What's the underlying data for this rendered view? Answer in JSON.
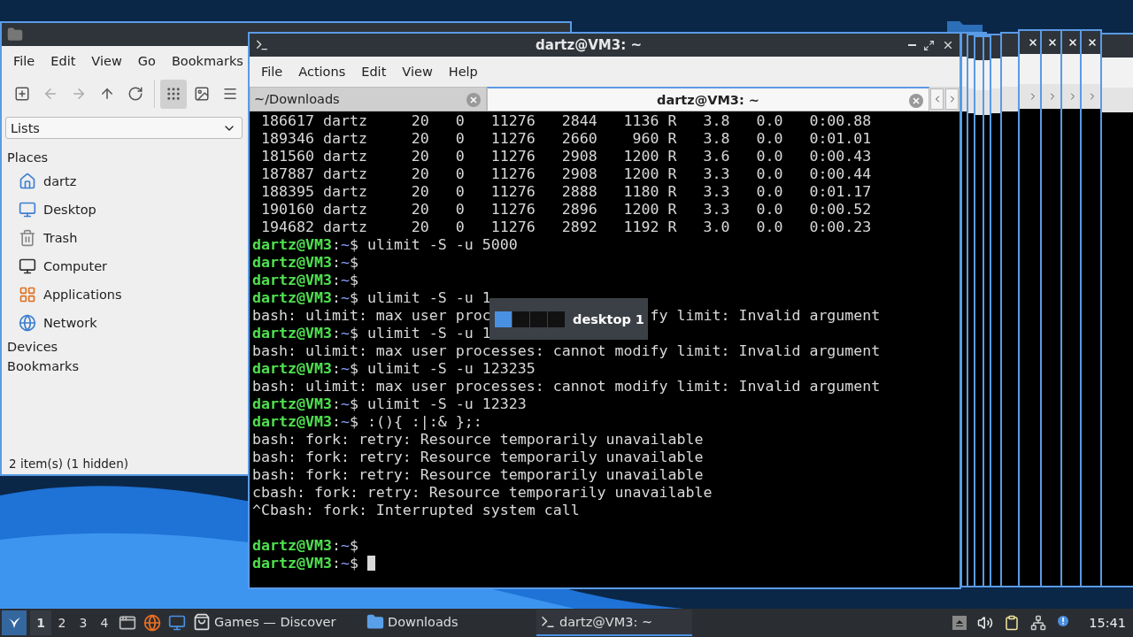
{
  "file_manager": {
    "menu": [
      "File",
      "Edit",
      "View",
      "Go",
      "Bookmarks"
    ],
    "view_modes": [
      {
        "kind": "icons",
        "selected": true
      },
      {
        "kind": "thumbnails",
        "selected": false
      },
      {
        "kind": "list",
        "selected": false
      }
    ],
    "view_select": {
      "value": "Lists"
    },
    "sections": [
      {
        "title": "Places",
        "items": [
          {
            "label": "dartz",
            "kind": "home"
          },
          {
            "label": "Desktop",
            "kind": "desktop"
          },
          {
            "label": "Trash",
            "kind": "trash"
          },
          {
            "label": "Computer",
            "kind": "computer"
          },
          {
            "label": "Applications",
            "kind": "apps"
          },
          {
            "label": "Network",
            "kind": "network"
          }
        ]
      },
      {
        "title": "Devices"
      },
      {
        "title": "Bookmarks"
      }
    ],
    "status": "2 item(s) (1 hidden)"
  },
  "terminal": {
    "title": "dartz@VM3: ~",
    "menu": [
      "File",
      "Actions",
      "Edit",
      "View",
      "Help"
    ],
    "tabs": [
      {
        "label": "~/Downloads",
        "selected": false
      },
      {
        "label": "dartz@VM3: ~",
        "selected": true
      }
    ],
    "lines": [
      {
        "kind": "output",
        "text": " 186617 dartz     20   0   11276   2844   1136 R   3.8   0.0   0:00.88"
      },
      {
        "kind": "output",
        "text": " 189346 dartz     20   0   11276   2660    960 R   3.8   0.0   0:01.01"
      },
      {
        "kind": "output",
        "text": " 181560 dartz     20   0   11276   2908   1200 R   3.6   0.0   0:00.43"
      },
      {
        "kind": "output",
        "text": " 187887 dartz     20   0   11276   2908   1200 R   3.3   0.0   0:00.44"
      },
      {
        "kind": "output",
        "text": " 188395 dartz     20   0   11276   2888   1180 R   3.3   0.0   0:01.17"
      },
      {
        "kind": "output",
        "text": " 190160 dartz     20   0   11276   2896   1200 R   3.3   0.0   0:00.52"
      },
      {
        "kind": "output",
        "text": " 194682 dartz     20   0   11276   2892   1192 R   3.0   0.0   0:00.23"
      },
      {
        "kind": "prompt",
        "user": "dartz@VM3",
        "sep": ":",
        "path": "~",
        "symbol": "$",
        "command": " ulimit -S -u 5000"
      },
      {
        "kind": "prompt",
        "user": "dartz@VM3",
        "sep": ":",
        "path": "~",
        "symbol": "$"
      },
      {
        "kind": "prompt",
        "user": "dartz@VM3",
        "sep": ":",
        "path": "~",
        "symbol": "$"
      },
      {
        "kind": "prompt",
        "user": "dartz@VM3",
        "sep": ":",
        "path": "~",
        "symbol": "$",
        "command": " ulimit -S -u 1"
      },
      {
        "kind": "output",
        "text": "bash: ulimit: max user proc",
        "after": "fy limit: Invalid argument"
      },
      {
        "kind": "prompt",
        "user": "dartz@VM3",
        "sep": ":",
        "path": "~",
        "symbol": "$",
        "command": " ulimit -S -u 1"
      },
      {
        "kind": "output",
        "text": "bash: ulimit: max user processes: cannot modify limit: Invalid argument"
      },
      {
        "kind": "prompt",
        "user": "dartz@VM3",
        "sep": ":",
        "path": "~",
        "symbol": "$",
        "command": " ulimit -S -u 123235"
      },
      {
        "kind": "output",
        "text": "bash: ulimit: max user processes: cannot modify limit: Invalid argument"
      },
      {
        "kind": "prompt",
        "user": "dartz@VM3",
        "sep": ":",
        "path": "~",
        "symbol": "$",
        "command": " ulimit -S -u 12323"
      },
      {
        "kind": "prompt",
        "user": "dartz@VM3",
        "sep": ":",
        "path": "~",
        "symbol": "$",
        "command": " :(){ :|:& };:"
      },
      {
        "kind": "output",
        "text": "bash: fork: retry: Resource temporarily unavailable"
      },
      {
        "kind": "output",
        "text": "bash: fork: retry: Resource temporarily unavailable"
      },
      {
        "kind": "output",
        "text": "bash: fork: retry: Resource temporarily unavailable"
      },
      {
        "kind": "output",
        "text": "cbash: fork: retry: Resource temporarily unavailable"
      },
      {
        "kind": "output",
        "text": "^Cbash: fork: Interrupted system call"
      },
      {
        "kind": "blank"
      },
      {
        "kind": "prompt",
        "user": "dartz@VM3",
        "sep": ":",
        "path": "~",
        "symbol": "$"
      },
      {
        "kind": "prompt",
        "user": "dartz@VM3",
        "sep": ":",
        "path": "~",
        "symbol": "$",
        "cursor": true
      }
    ]
  },
  "desktop_popup": {
    "label": "desktop 1",
    "desktops": [
      {
        "selected": true
      },
      {
        "selected": false
      },
      {
        "selected": false
      },
      {
        "selected": false
      }
    ]
  },
  "taskbar": {
    "desktops": [
      {
        "label": "1",
        "selected": true
      },
      {
        "label": "2",
        "selected": false
      },
      {
        "label": "3",
        "selected": false
      },
      {
        "label": "4",
        "selected": false
      }
    ],
    "tasks": [
      {
        "label": "Games — Discover",
        "kind": "discover",
        "selected": false
      },
      {
        "label": "Downloads",
        "kind": "folder",
        "selected": false
      },
      {
        "label": "dartz@VM3: ~",
        "kind": "terminal",
        "selected": true
      }
    ],
    "clock": "15:41"
  }
}
